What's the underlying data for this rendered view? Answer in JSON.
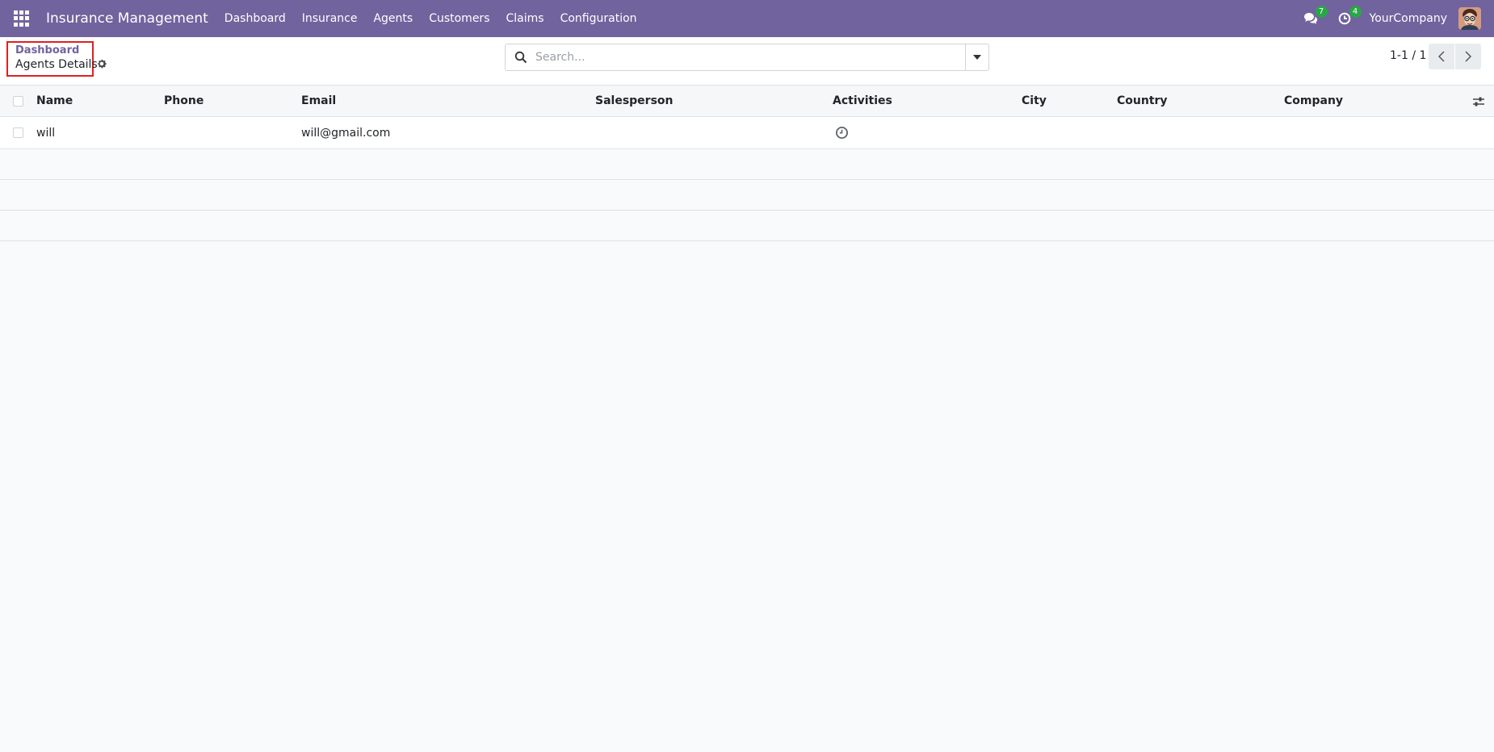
{
  "navbar": {
    "brand": "Insurance Management",
    "menu": [
      "Dashboard",
      "Insurance",
      "Agents",
      "Customers",
      "Claims",
      "Configuration"
    ],
    "messages_count": "7",
    "activities_count": "4",
    "company": "YourCompany"
  },
  "control_panel": {
    "breadcrumb_parent": "Dashboard",
    "breadcrumb_current": "Agents Details",
    "search_placeholder": "Search...",
    "pager": "1-1 / 1"
  },
  "table": {
    "columns": [
      "Name",
      "Phone",
      "Email",
      "Salesperson",
      "Activities",
      "City",
      "Country",
      "Company"
    ],
    "rows": [
      {
        "name": "will",
        "phone": "",
        "email": "will@gmail.com",
        "salesperson": "",
        "city": "",
        "country": "",
        "company": ""
      }
    ]
  },
  "colors": {
    "navbar": "#71639e",
    "badge": "#28a745",
    "highlight": "#e02020"
  }
}
